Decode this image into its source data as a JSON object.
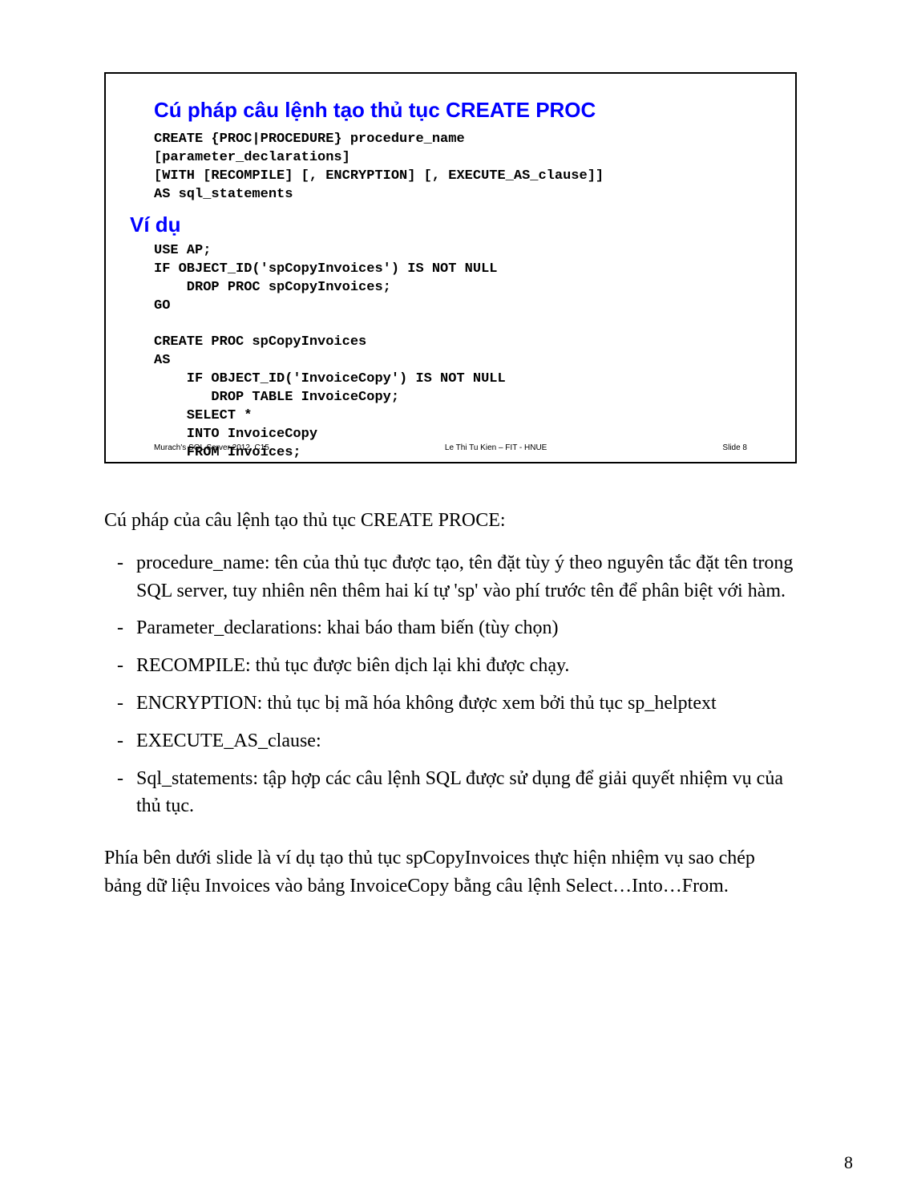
{
  "slide": {
    "title": "Cú pháp câu lệnh tạo thủ tục CREATE PROC",
    "syntax": "CREATE {PROC|PROCEDURE} procedure_name\n[parameter_declarations]\n[WITH [RECOMPILE] [, ENCRYPTION] [, EXECUTE_AS_clause]]\nAS sql_statements",
    "example_title": "Ví dụ",
    "example_code": "USE AP;\nIF OBJECT_ID('spCopyInvoices') IS NOT NULL\n    DROP PROC spCopyInvoices;\nGO\n\nCREATE PROC spCopyInvoices\nAS\n    IF OBJECT_ID('InvoiceCopy') IS NOT NULL\n       DROP TABLE InvoiceCopy;\n    SELECT *\n    INTO InvoiceCopy\n    FROM Invoices;",
    "footer_left": "Murach's SQL Server 2012, C15",
    "footer_center": "Le Thi Tu Kien – FIT - HNUE",
    "footer_right": "Slide 8"
  },
  "body": {
    "intro": "Cú pháp của câu lệnh tạo thủ tục CREATE PROCE:",
    "bullets": [
      "procedure_name: tên của thủ tục được tạo, tên đặt tùy ý theo nguyên tắc đặt tên trong SQL server, tuy nhiên nên thêm hai kí tự 'sp' vào phí trước tên để phân biệt với hàm.",
      "Parameter_declarations: khai báo tham biến (tùy chọn)",
      "RECOMPILE: thủ tục được biên dịch lại khi được chạy.",
      "ENCRYPTION: thủ tục bị mã hóa không được xem bởi thủ tục sp_helptext",
      "EXECUTE_AS_clause:",
      "Sql_statements: tập hợp các câu lệnh SQL được sử dụng để giải quyết nhiệm vụ của thủ tục."
    ],
    "closing": "Phía bên dưới slide là ví dụ tạo thủ tục spCopyInvoices thực hiện nhiệm vụ sao chép bảng dữ liệu Invoices vào bảng InvoiceCopy bằng câu lệnh Select…Into…From."
  },
  "page_number": "8"
}
